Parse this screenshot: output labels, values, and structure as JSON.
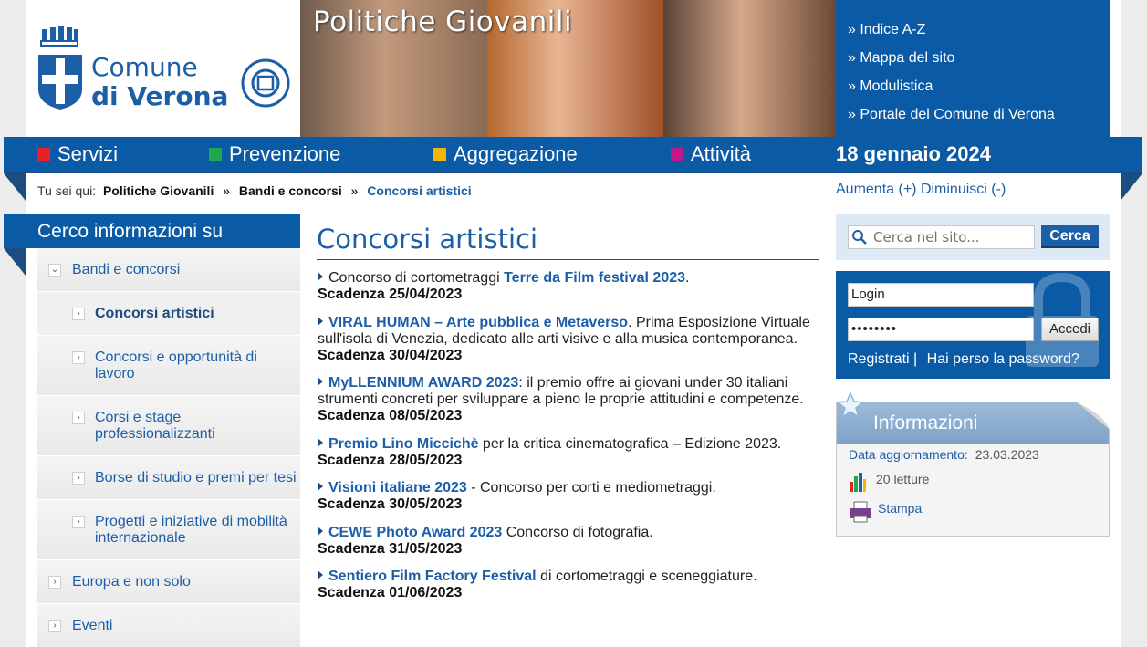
{
  "header": {
    "logo_line1": "Comune",
    "logo_line2": "di Verona",
    "banner_title": "Politiche Giovanili",
    "quicklinks": [
      "» Indice A-Z",
      "» Mappa del sito",
      "» Modulistica",
      "» Portale del Comune di Verona"
    ]
  },
  "nav": {
    "items": [
      {
        "label": "Servizi",
        "color": "#e8202a"
      },
      {
        "label": "Prevenzione",
        "color": "#1fa84f"
      },
      {
        "label": "Aggregazione",
        "color": "#f2b705"
      },
      {
        "label": "Attività",
        "color": "#c2188b"
      }
    ],
    "date": "18 gennaio 2024"
  },
  "breadcrumb": {
    "prefix": "Tu sei qui:",
    "items": [
      "Politiche Giovanili",
      "Bandi e concorsi",
      "Concorsi artistici"
    ],
    "separator": "»"
  },
  "fontsize": {
    "increase": "Aumenta (+)",
    "decrease": "Diminuisci (-)"
  },
  "leftmenu": {
    "title": "Cerco informazioni su",
    "items": [
      {
        "label": "Bandi e concorsi"
      },
      {
        "label": "Concorsi artistici"
      },
      {
        "label": "Concorsi e opportunità di lavoro"
      },
      {
        "label": "Corsi e stage professionalizzanti"
      },
      {
        "label": "Borse di studio e premi per tesi"
      },
      {
        "label": "Progetti e iniziative di mobilità internazionale"
      },
      {
        "label": "Europa e non solo"
      },
      {
        "label": "Eventi"
      }
    ]
  },
  "main": {
    "title": "Concorsi artistici",
    "entries": [
      {
        "pre": "Concorso di cortometraggi ",
        "link": "Terre da Film festival 2023",
        "post": ".",
        "deadline": "Scadenza 25/04/2023"
      },
      {
        "pre": "",
        "link": "VIRAL HUMAN – Arte pubblica e Metaverso",
        "post": ". Prima Esposizione Virtuale sull'isola di Venezia, dedicato alle arti visive e alla musica contemporanea.",
        "deadline": "Scadenza 30/04/2023"
      },
      {
        "pre": "",
        "link": "MyLLENNIUM AWARD 2023",
        "post": ": il premio offre ai giovani under 30 italiani strumenti concreti per sviluppare a pieno le proprie attitudini e competenze.",
        "deadline": "Scadenza 08/05/2023"
      },
      {
        "pre": "",
        "link": "Premio Lino Miccichè",
        "post": " per la critica cinematografica – Edizione 2023.",
        "deadline": "Scadenza 28/05/2023"
      },
      {
        "pre": "",
        "link": "Visioni italiane 2023",
        "post": " - Concorso per corti e mediometraggi.",
        "deadline": "Scadenza 30/05/2023"
      },
      {
        "pre": "",
        "link": "CEWE Photo Award 2023",
        "post": " Concorso di fotografia.",
        "deadline": "Scadenza 31/05/2023"
      },
      {
        "pre": "",
        "link": "Sentiero Film Factory Festival",
        "post": " di cortometraggi e sceneggiature.",
        "deadline": "Scadenza 01/06/2023"
      }
    ]
  },
  "search": {
    "placeholder": "Cerca nel sito...",
    "button": "Cerca"
  },
  "login": {
    "username": "Login",
    "password": "••••••••",
    "button": "Accedi",
    "register": "Registrati |",
    "lost_password": "Hai perso la password?"
  },
  "info": {
    "title": "Informazioni",
    "updated_label": "Data aggiornamento:",
    "updated_value": "23.03.2023",
    "reads": "20 letture",
    "print": "Stampa"
  }
}
